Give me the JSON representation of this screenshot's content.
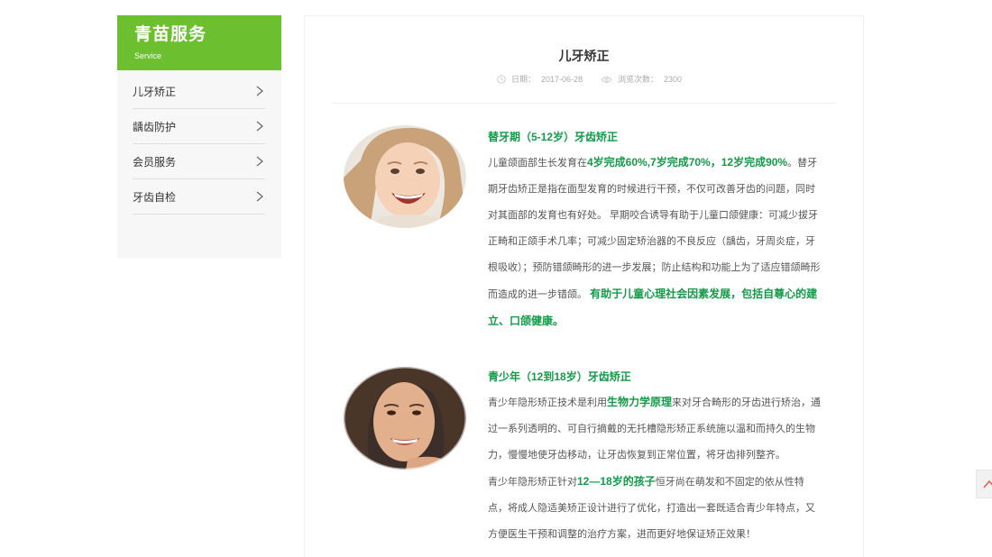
{
  "sidebar": {
    "title": "青苗服务",
    "subtitle": "Service",
    "items": [
      {
        "label": "儿牙矫正"
      },
      {
        "label": "龋齿防护"
      },
      {
        "label": "会员服务"
      },
      {
        "label": "牙齿自检"
      }
    ]
  },
  "article": {
    "title": "儿牙矫正",
    "date_label": "日期：",
    "date": "2017-06-28",
    "views_label": "浏览次数：",
    "views": "2300"
  },
  "section1": {
    "heading": "替牙期（5-12岁）牙齿矫正",
    "p_a": "儿童颌面部生长发育在",
    "p_hl": "4岁完成60%,7岁完成70%，12岁完成90%",
    "p_b": "。替牙期牙齿矫正是指在面型发育的时候进行干预，不仅可改善牙齿的问题，同时对其面部的发育也有好处。 早期咬合诱导有助于儿童口颌健康：可减少拔牙正畸和正颌手术几率；可减少固定矫治器的不良反应（龋齿，牙周炎症，牙根吸收）；预防错颌畸形的进一步发展；防止结构和功能上为了适应错颌畸形而造成的进一步错颌。 ",
    "p_hl2": "有助于儿童心理社会因素发展，包括自尊心的建立、口颌健康。"
  },
  "section2": {
    "heading": "青少年（12到18岁）牙齿矫正",
    "p1_a": "青少年隐形矫正技术是利用",
    "p1_hl": "生物力学原理",
    "p1_b": "来对牙合畸形的牙齿进行矫治，通过一系列透明的、可自行摘戴的无托槽隐形矫正系统施以温和而持久的生物力，慢慢地使牙齿移动，让牙齿恢复到正常位置，将牙齿排列整齐。",
    "p2_a": "青少年隐形矫正针对",
    "p2_hl": "12—18岁的孩子",
    "p2_b": "恒牙尚在萌发和不固定的依从性特点，将成人隐适美矫正设计进行了优化，打造出一套既适合青少年特点，又方便医生干预和调整的治疗方案，进而更好地保证矫正效果！"
  },
  "colors": {
    "brand_green": "#6cbf2e",
    "highlight_green": "#119b47"
  },
  "icons": {
    "nav_arrow": "chevron-right-icon",
    "date": "clock-icon",
    "views": "eye-icon",
    "back_to_top": "chevron-up-icon"
  }
}
